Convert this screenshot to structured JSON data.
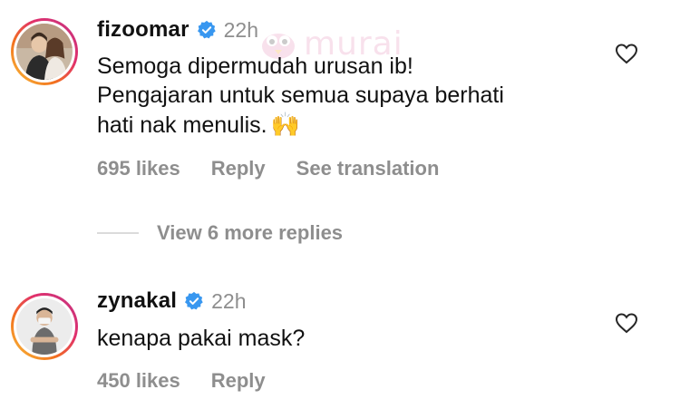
{
  "comments": [
    {
      "username": "fizoomar",
      "time": "22h",
      "text_lines": [
        "Semoga dipermudah urusan ib!",
        "Pengajaran untuk semua supaya berhati",
        "hati nak menulis."
      ],
      "emoji": "🙌",
      "likes": "695 likes",
      "reply": "Reply",
      "see_translation": "See translation",
      "view_replies": "View 6 more replies"
    },
    {
      "username": "zynakal",
      "time": "22h",
      "text_lines": [
        "kenapa pakai mask?"
      ],
      "likes": "450 likes",
      "reply": "Reply"
    }
  ],
  "watermark": {
    "text": "murai"
  },
  "colors": {
    "verified": "#3897f0",
    "muted": "#8e8e8e",
    "ring_start": "#f9c33a",
    "ring_end": "#c13584"
  },
  "icons": [
    "verified-badge-icon",
    "heart-icon",
    "raising-hands-emoji"
  ]
}
